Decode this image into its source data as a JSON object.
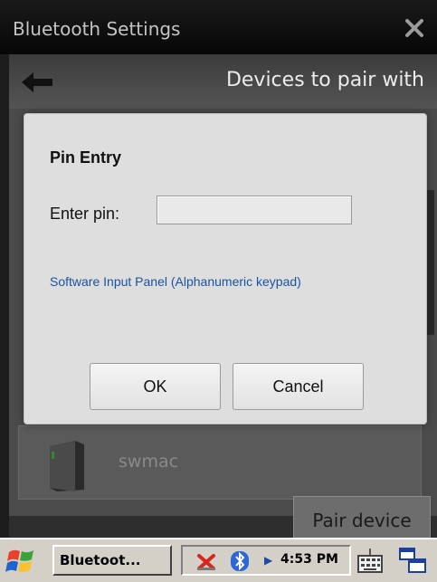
{
  "window": {
    "title": "Bluetooth Settings",
    "close_icon": "close-x-icon"
  },
  "header": {
    "title": "Devices to pair with",
    "back_icon": "back-arrow-icon"
  },
  "device": {
    "name": "swmac",
    "icon": "computer-tower-icon"
  },
  "pair_button": {
    "label": "Pair device"
  },
  "dialog": {
    "title": "Pin Entry",
    "pin_label": "Enter pin:",
    "pin_value": "",
    "sip_link": "Software Input Panel (Alphanumeric keypad)",
    "ok_label": "OK",
    "cancel_label": "Cancel"
  },
  "taskbar": {
    "start_icon": "windows-flag-icon",
    "task_label": "Bluetoot...",
    "clock": "4:53 PM",
    "tray_icons": [
      "connection-error-icon",
      "bluetooth-icon",
      "tray-expand-arrow-icon"
    ],
    "keyboard_icon": "keyboard-icon",
    "windows_icon": "window-switcher-icon"
  }
}
